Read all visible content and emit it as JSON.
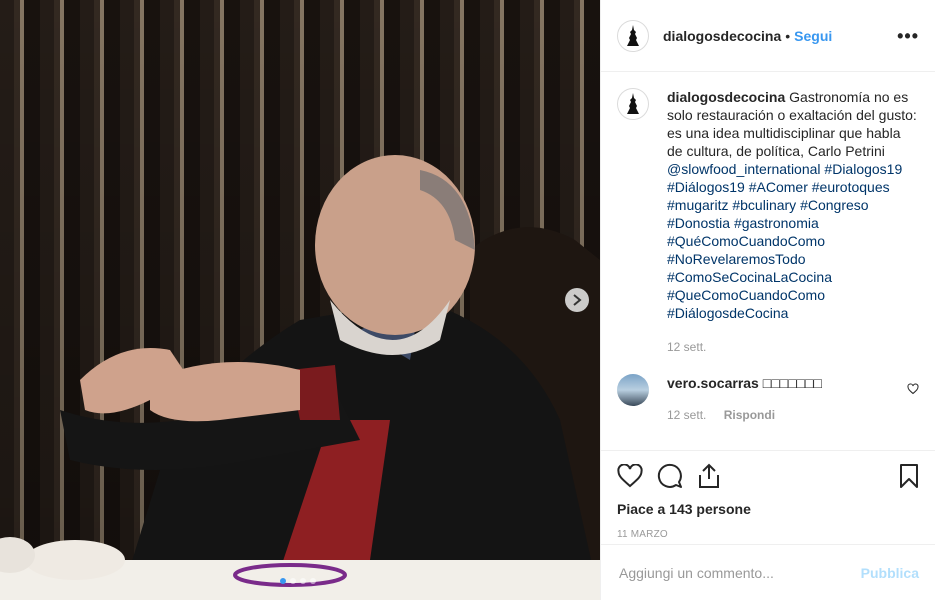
{
  "post": {
    "username": "dialogosdecocina",
    "separator": "•",
    "follow_label": "Segui",
    "more_label": "•••",
    "caption_text": "Gastronomía no es solo restauración o exaltación del gusto: es una idea multidisciplinar que habla de cultura, de política, Carlo Petrini",
    "mention": "@slowfood_international",
    "hashtags": [
      "#Dialogos19",
      "#Diálogos19",
      "#AComer",
      "#eurotoques",
      "#mugaritz",
      "#bculinary",
      "#Congreso",
      "#Donostia",
      "#gastronomia",
      "#QuéComoCuandoComo",
      "#NoRevelaremosTodo",
      "#ComoSeCocinaLaCocina",
      "#QueComoCuandoComo",
      "#DiálogosdeCocina"
    ],
    "caption_time": "12 sett.",
    "likes_label": "Piace a 143 persone",
    "date_label": "11 MARZO"
  },
  "comment": {
    "username": "vero.socarras",
    "text": "□□□□□□□",
    "time": "12 sett.",
    "reply_label": "Rispondi"
  },
  "add_comment": {
    "placeholder": "Aggiungi un commento...",
    "publish_label": "Pubblica"
  },
  "carousel": {
    "slides": 4,
    "active": 1
  },
  "icons": {
    "header": "more-options-icon",
    "actions": [
      "heart-icon",
      "comment-icon",
      "share-icon",
      "bookmark-icon"
    ]
  },
  "colors": {
    "link": "#003569",
    "accent": "#3897f0",
    "publish_disabled": "#b2dffc",
    "muted": "#999999"
  }
}
